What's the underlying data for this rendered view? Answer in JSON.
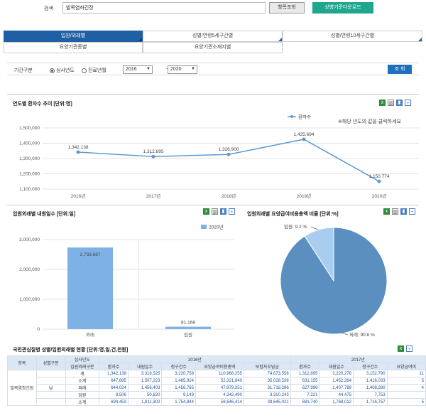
{
  "search": {
    "label": "검색",
    "value": "발목염좌긴장"
  },
  "buttons": {
    "lookup": "항목조회",
    "download": "상병기준다운로드",
    "query": "조 회"
  },
  "tabs": [
    "입원/외래별",
    "성별/연령5세구간별",
    "성별/연령10세구간별",
    "요양기관종별",
    "요양기관소재지별"
  ],
  "filter": {
    "label": "기간구분",
    "radio1": "심사년도",
    "radio2": "진료년월",
    "from": "2016",
    "tilde": "~",
    "to": "2020"
  },
  "colors": {
    "primary": "#1f5fa3",
    "teal": "#1fa68f",
    "line": "#5b9bd5",
    "pie": "#5a8fc0",
    "pie_light": "#a9cdef"
  },
  "line_panel": {
    "title": "연도별 환자수 추이 [단위:명]",
    "note": "※해당 년도의 값을 클릭하세요"
  },
  "bar_panel": {
    "title": "입원외래별 내원일수 [단위:일]"
  },
  "pie_panel": {
    "title": "입원외래별 요양급여비용총액 비율 [단위:%]"
  },
  "chart_data": [
    {
      "type": "line",
      "title": "연도별 환자수 추이 [단위:명]",
      "series": [
        {
          "name": "환자수",
          "values": [
            1342138,
            1312895,
            1326900,
            1425694,
            1150774
          ]
        }
      ],
      "x": [
        "2016년",
        "2017년",
        "2018년",
        "2019년",
        "2020년"
      ],
      "value_labels": [
        "1,342,138",
        "1,312,895",
        "1,326,900",
        "1,425,694",
        "1,150,774"
      ],
      "ylim": [
        1100000,
        1500000
      ],
      "yticks": [
        "1,500,000",
        "1,400,000",
        "1,300,000",
        "1,200,000",
        "1,100,000"
      ],
      "legend": "top-right"
    },
    {
      "type": "bar",
      "title": "입원외래별 내원일수 [단위:일]",
      "categories": [
        "외래",
        "입원"
      ],
      "series": [
        {
          "name": "2020년",
          "values": [
            2733687,
            81168
          ]
        }
      ],
      "value_labels": [
        "2,733,687",
        "81,168"
      ],
      "ylim": [
        0,
        3000000
      ],
      "yticks": [
        "3,000,000",
        "2,000,000",
        "1,000,000",
        "0"
      ],
      "legend": "top-center"
    },
    {
      "type": "pie",
      "title": "입원외래별 요양급여비용총액 비율 [단위:%]",
      "categories": [
        "외래",
        "입원"
      ],
      "values": [
        90.8,
        9.2
      ],
      "labels": [
        "외래: 90.8 %",
        "입원: 9.2 %"
      ]
    }
  ],
  "table": {
    "title": "국민관심질병 성별/입원외래별 현황 [단위:명,일,건,천원]",
    "header_top": [
      "항목",
      "성별구분",
      "심사년도",
      "2016년",
      "2017년"
    ],
    "header_sub": [
      "입원외래구분",
      "환자수",
      "내원일수",
      "청구건수",
      "요양급여비용총액",
      "보험자부담금",
      "환자수",
      "내원일수",
      "청구건수",
      "요양급여비"
    ],
    "item": "발목염좌긴장",
    "gender": "남",
    "rows": [
      {
        "type": "계",
        "v": [
          "1,342,138",
          "3,318,525",
          "3,220,758",
          "110,968,255",
          "74,673,558",
          "1,312,895",
          "3,220,276",
          "3,152,790",
          "11"
        ]
      },
      {
        "type": "소계",
        "v": [
          "647,685",
          "1,507,223",
          "1,465,914",
          "52,321,840",
          "35,028,538",
          "631,155",
          "1,452,264",
          "1,416,033",
          "5"
        ]
      },
      {
        "type": "외래",
        "v": [
          "644,024",
          "1,456,403",
          "1,456,765",
          "47,979,351",
          "31,718,296",
          "627,996",
          "1,407,789",
          "1,408,280",
          "4"
        ]
      },
      {
        "type": "입원",
        "v": [
          "8,506",
          "50,820",
          "9,149",
          "4,342,490",
          "3,310,243",
          "7,221",
          "44,475",
          "7,753",
          ""
        ]
      },
      {
        "type": "소계",
        "v": [
          "694,453",
          "1,811,302",
          "1,754,844",
          "58,646,414",
          "39,645,021",
          "681,740",
          "1,768,012",
          "1,716,757",
          "5"
        ]
      }
    ]
  }
}
